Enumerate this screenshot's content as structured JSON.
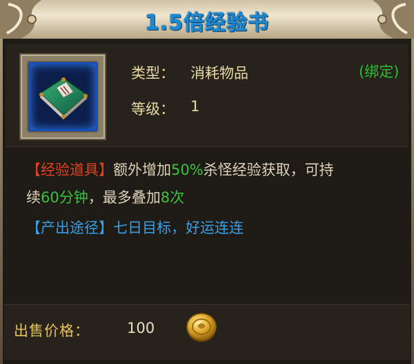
{
  "title": "1.5倍经验书",
  "item": {
    "icon": "green-book-icon",
    "type_label": "类型：",
    "type_value": "消耗物品",
    "bind_status": "(绑定)",
    "level_label": "等级：",
    "level_value": "1"
  },
  "description": {
    "tag": "【经验道具】",
    "text1": "额外增加",
    "pct": "50%",
    "text2": "杀怪经验获取，可持",
    "text3": "续",
    "duration": "60分钟",
    "text4": "，最多叠加",
    "stack": "8次",
    "source_tag": "【产出途径】",
    "source_text": "七日目标，好运连连"
  },
  "sell": {
    "label": "出售价格：",
    "price": "100",
    "currency_icon": "gold-coin-icon"
  },
  "colors": {
    "title": "#1c8ad2",
    "label": "#e8d9a6",
    "bind": "#2cc12c",
    "tag_red": "#e0421c",
    "highlight_green": "#39c43b",
    "source_blue": "#3aa0e4",
    "sell_label": "#e5c35a"
  }
}
